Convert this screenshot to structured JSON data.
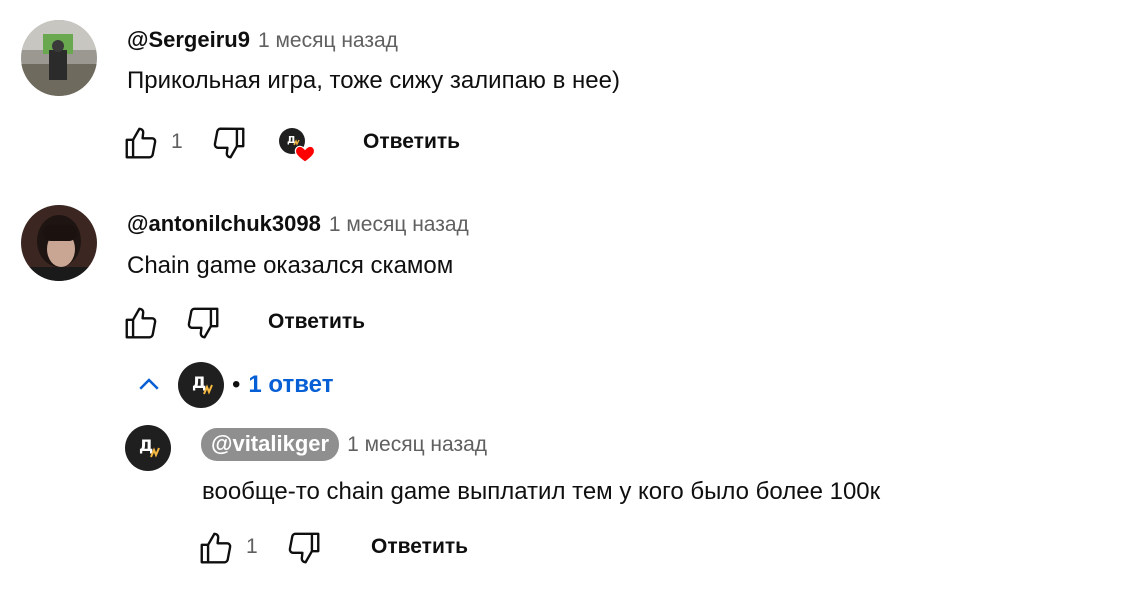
{
  "comments": [
    {
      "author": "@Sergeiru9",
      "time": "1 месяц назад",
      "text": "Прикольная игра, тоже сижу залипаю в нее)",
      "likes": "1",
      "reply_label": "Ответить"
    },
    {
      "author": "@antonilchuk3098",
      "time": "1 месяц назад",
      "text": "Chain game оказался скамом",
      "reply_label": "Ответить",
      "replies_toggle": {
        "bullet": "•",
        "label": "1 ответ"
      }
    }
  ],
  "reply": {
    "author": "@vitalikger",
    "time": "1 месяц назад",
    "text": "вообще-то chain game выплатил тем у кого было более 100к",
    "likes": "1",
    "reply_label": "Ответить"
  },
  "colors": {
    "link": "#065fd4",
    "heart": "#ff0000",
    "muted": "#606060",
    "chip_bg": "#8f8f8f"
  },
  "icons": {
    "like": "thumbs-up-icon",
    "dislike": "thumbs-down-icon",
    "heart": "heart-icon",
    "collapse": "chevron-up-icon"
  }
}
